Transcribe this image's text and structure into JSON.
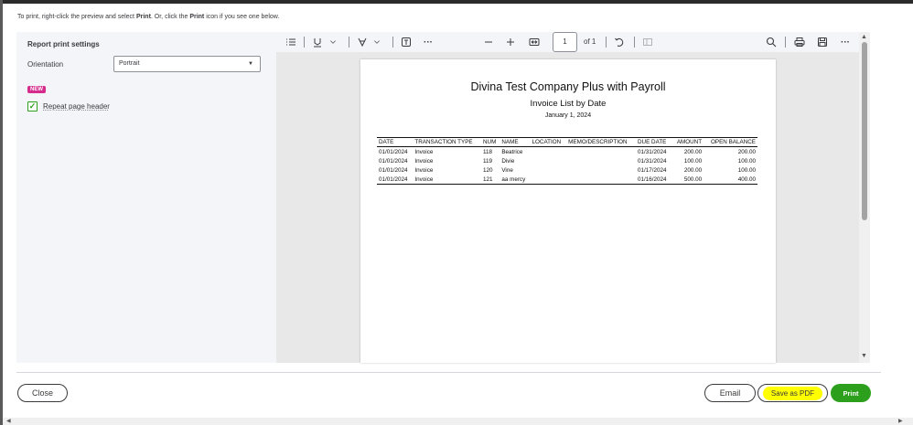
{
  "instructions": {
    "part1": "To print, right-click the preview and select ",
    "bold1": "Print",
    "part2": ". Or, click the ",
    "bold2": "Print",
    "part3": " icon if you see one below."
  },
  "settings": {
    "title": "Report print settings",
    "orientation_label": "Orientation",
    "orientation_value": "Portrait",
    "new_badge": "NEW",
    "repeat_header_label": "Repeat page header",
    "repeat_header_checked": true
  },
  "toolbar": {
    "page_number": "1",
    "page_of": "of 1",
    "icons": [
      "list-icon",
      "highlight-icon",
      "chevron-down-icon",
      "draw-icon",
      "chevron-down-icon",
      "text-box-icon",
      "more-icon",
      "zoom-out-icon",
      "zoom-in-icon",
      "fit-page-icon",
      "rotate-icon",
      "page-view-icon",
      "search-icon",
      "printer-icon",
      "save-icon",
      "more-icon"
    ]
  },
  "report": {
    "company": "Divina Test Company Plus with Payroll",
    "title": "Invoice List by Date",
    "date": "January 1, 2024",
    "columns": [
      "DATE",
      "TRANSACTION TYPE",
      "NUM",
      "NAME",
      "LOCATION",
      "MEMO/DESCRIPTION",
      "DUE DATE",
      "AMOUNT",
      "OPEN BALANCE"
    ],
    "rows": [
      [
        "01/01/2024",
        "Invoice",
        "118",
        "Beatrice",
        "",
        "",
        "01/31/2024",
        "200.00",
        "200.00"
      ],
      [
        "01/01/2024",
        "Invoice",
        "119",
        "Divie",
        "",
        "",
        "01/31/2024",
        "100.00",
        "100.00"
      ],
      [
        "01/01/2024",
        "Invoice",
        "120",
        "Vine",
        "",
        "",
        "01/17/2024",
        "200.00",
        "100.00"
      ],
      [
        "01/01/2024",
        "Invoice",
        "121",
        "aa mercy",
        "",
        "",
        "01/16/2024",
        "500.00",
        "400.00"
      ]
    ]
  },
  "buttons": {
    "close": "Close",
    "email": "Email",
    "save_pdf": "Save as PDF",
    "print": "Print"
  },
  "colors": {
    "primary_green": "#2ca01c",
    "new_badge": "#d52b8c",
    "highlight_yellow": "#ffff00"
  }
}
